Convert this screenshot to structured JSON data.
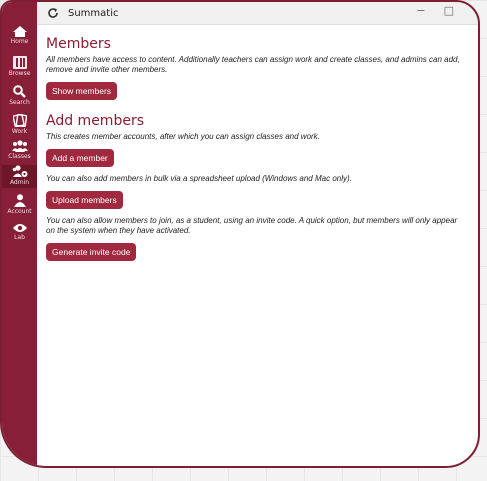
{
  "window": {
    "title": "Summatic",
    "minimize_glyph": "−",
    "maximize_glyph": "□"
  },
  "sidebar": {
    "items": [
      {
        "label": "Home",
        "icon": "home-icon"
      },
      {
        "label": "Browse",
        "icon": "book-icon"
      },
      {
        "label": "Search",
        "icon": "search-icon"
      },
      {
        "label": "Work",
        "icon": "pages-icon"
      },
      {
        "label": "Classes",
        "icon": "group-icon"
      },
      {
        "label": "Admin",
        "icon": "admin-users-icon",
        "active": true
      },
      {
        "label": "Account",
        "icon": "person-icon"
      },
      {
        "label": "Lab",
        "icon": "eye-icon"
      }
    ]
  },
  "members": {
    "heading": "Members",
    "description": "All members have access to content. Additionally teachers can assign work and create classes, and admins can add, remove and invite other members.",
    "show_button": "Show members"
  },
  "add_members": {
    "heading": "Add members",
    "add_desc": "This creates member accounts, after which you can assign classes and work.",
    "add_button": "Add a member",
    "upload_desc": "You can also add members in bulk via a spreadsheet upload (Windows and Mac only).",
    "upload_button": "Upload members",
    "invite_desc": "You can also allow members to join, as a student, using an invite code. A quick option, but members will only appear on the system when they have activated.",
    "invite_button": "Generate invite code"
  },
  "colors": {
    "brand": "#861f37",
    "button": "#a0283f",
    "heading": "#8c1c33"
  }
}
